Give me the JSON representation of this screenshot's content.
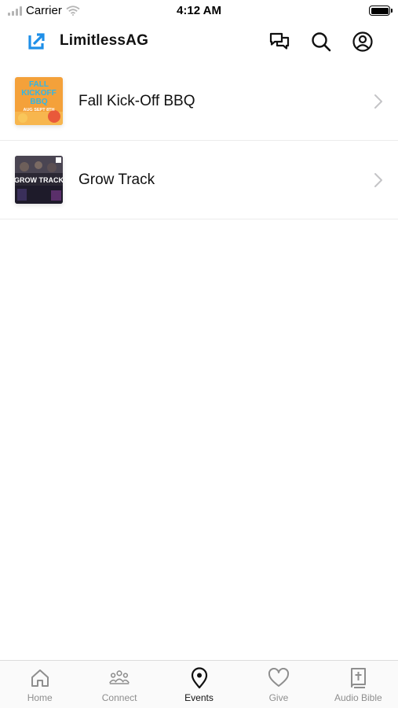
{
  "status_bar": {
    "carrier": "Carrier",
    "time": "4:12 AM"
  },
  "header": {
    "title": "LimitlessAG",
    "logo_icon": "limitless-arrow-logo",
    "actions": [
      "chat-icon",
      "search-icon",
      "profile-icon"
    ]
  },
  "events": [
    {
      "title": "Fall Kick-Off BBQ",
      "thumb_lines": [
        "FALL",
        "KICKOFF",
        "BBQ",
        "AUG SEPT 8TH"
      ],
      "thumb_colors": {
        "bg": "#f4a13a",
        "text": "#2fb6e8"
      }
    },
    {
      "title": "Grow Track",
      "thumb_lines": [
        "GROW TRACK"
      ],
      "thumb_colors": {
        "bg": "#2a2733",
        "text": "#ffffff"
      }
    }
  ],
  "tabs": [
    {
      "label": "Home",
      "icon": "home-icon",
      "active": false
    },
    {
      "label": "Connect",
      "icon": "people-icon",
      "active": false
    },
    {
      "label": "Events",
      "icon": "location-pin-icon",
      "active": true
    },
    {
      "label": "Give",
      "icon": "heart-icon",
      "active": false
    },
    {
      "label": "Audio Bible",
      "icon": "bible-icon",
      "active": false
    }
  ],
  "colors": {
    "brand": "#1e8fe8",
    "inactive": "#8e8e8e",
    "active": "#111111"
  }
}
